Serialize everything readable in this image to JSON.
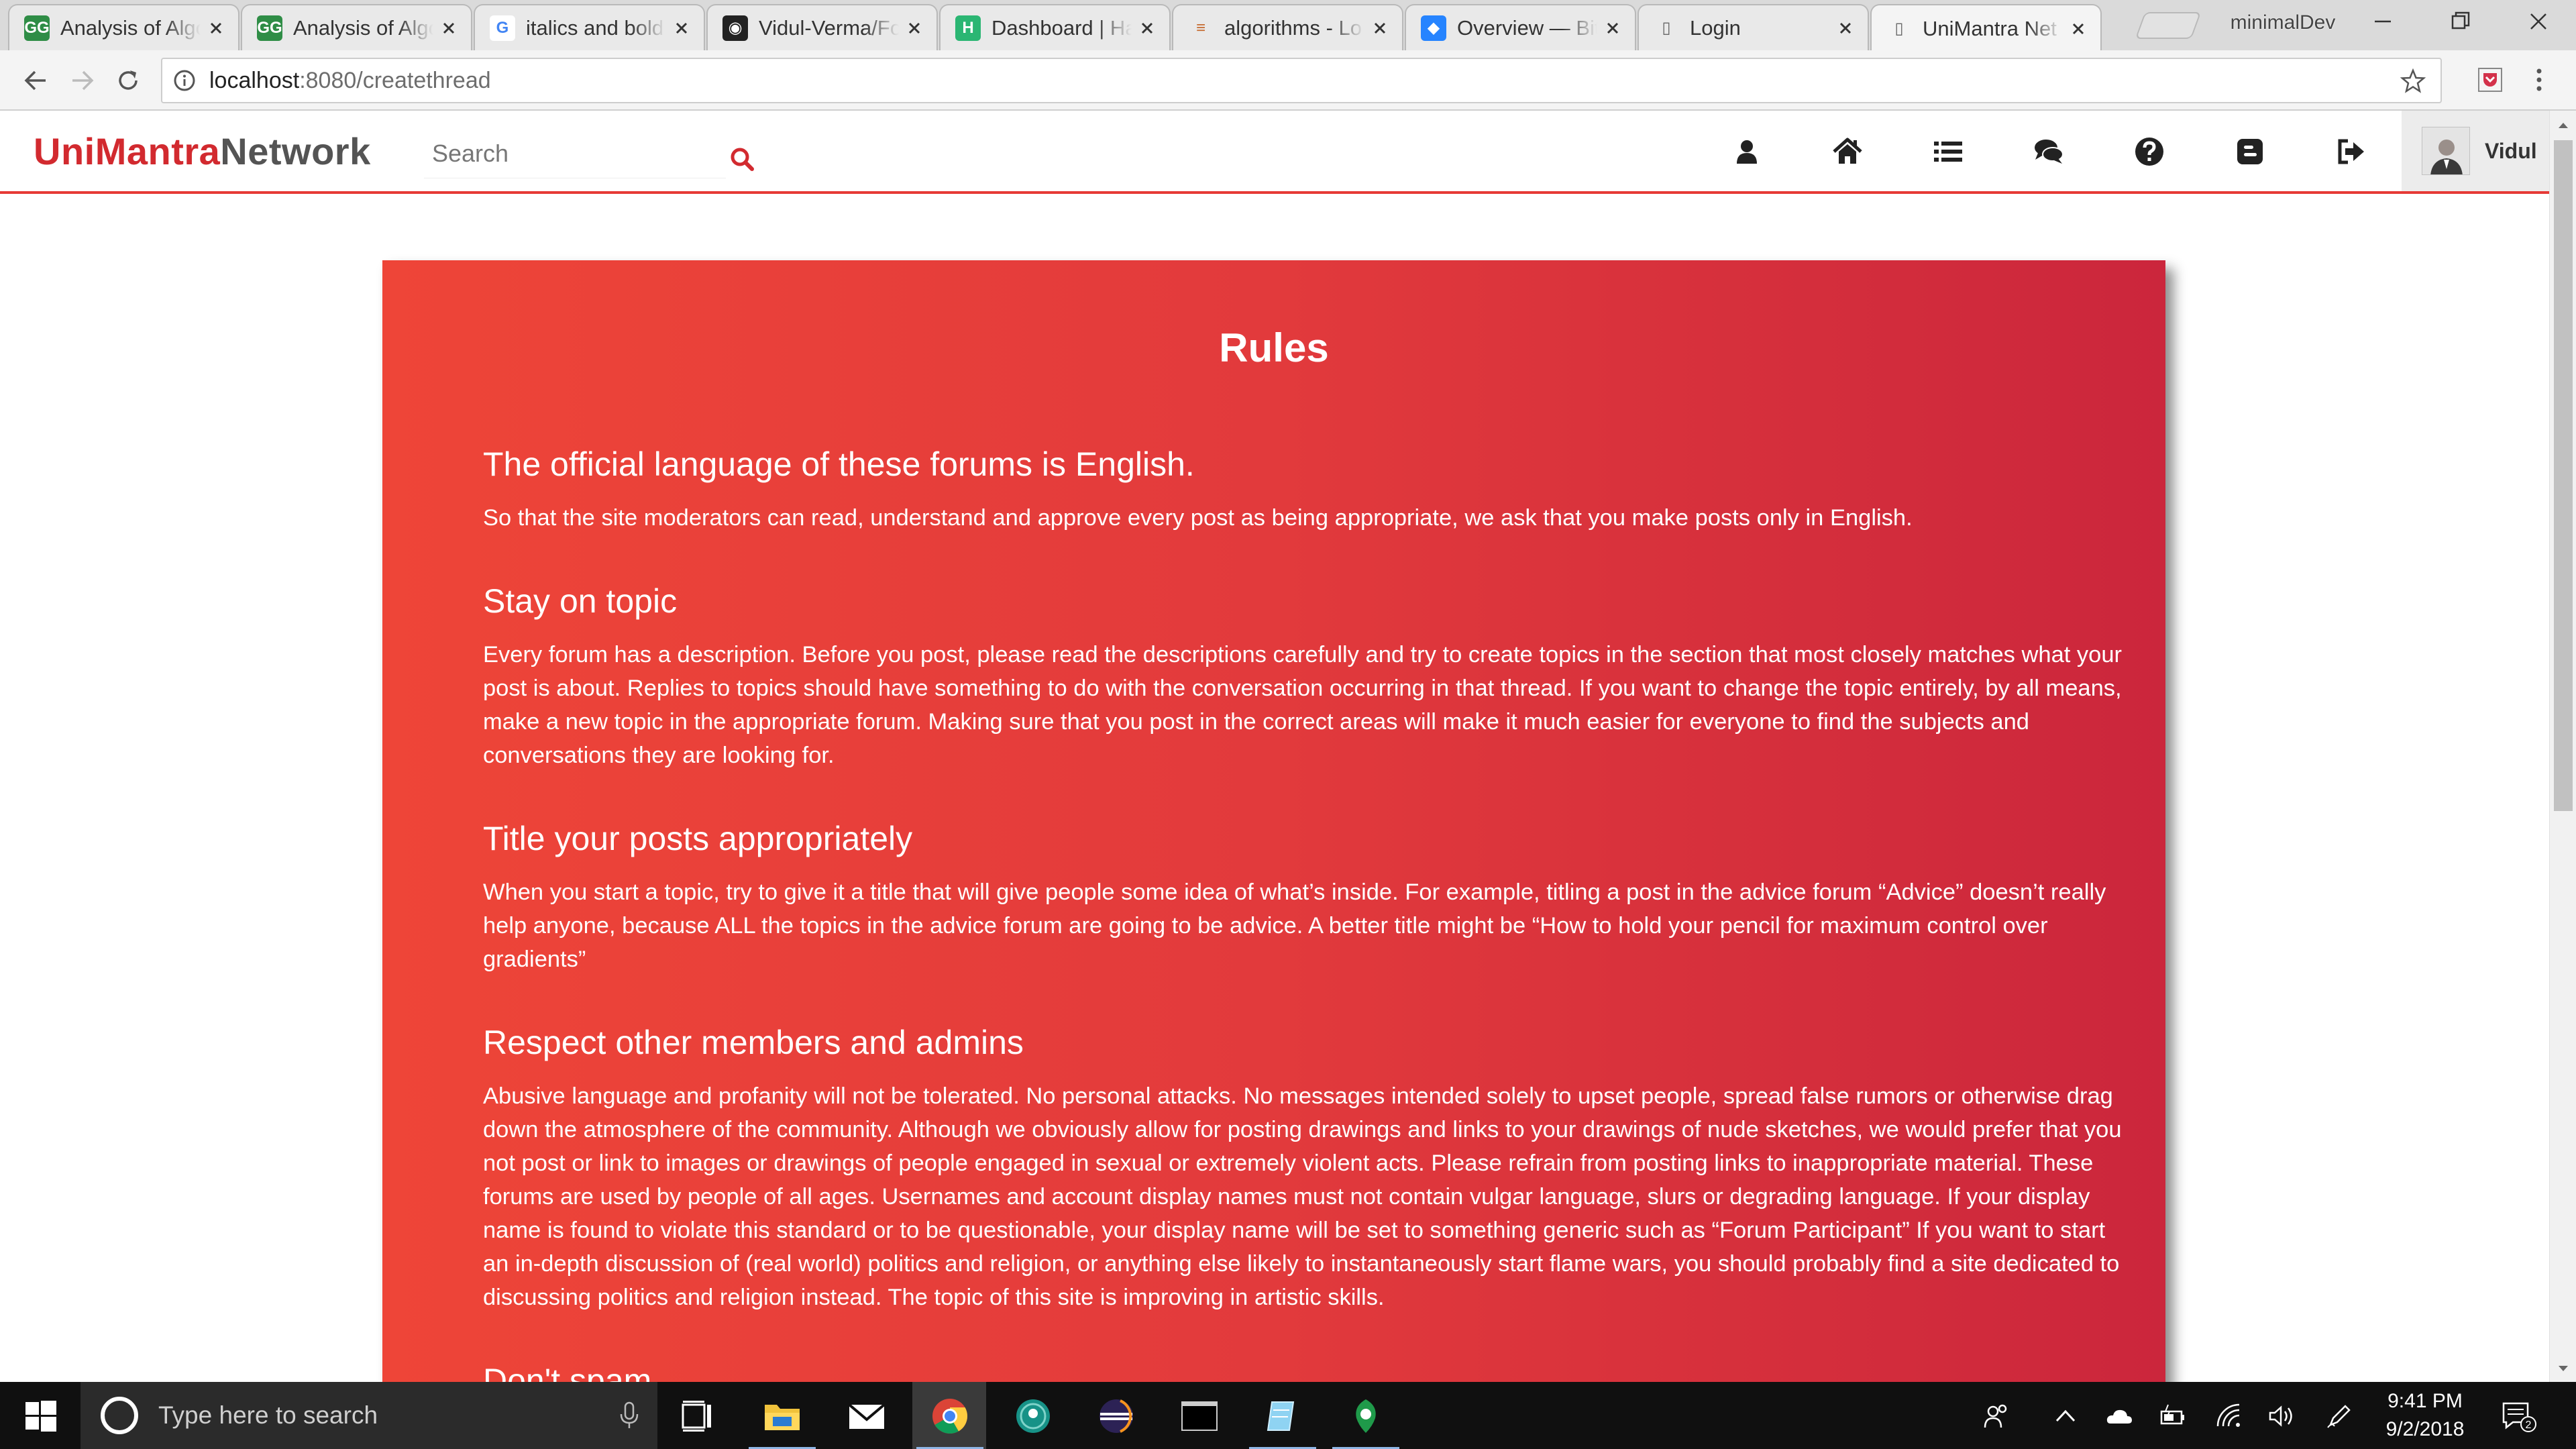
{
  "browser": {
    "tabs": [
      {
        "title": "Analysis of Algo",
        "favicon": "geeksforgeeks-icon"
      },
      {
        "title": "Analysis of Algo",
        "favicon": "geeksforgeeks-icon"
      },
      {
        "title": "italics and bold",
        "favicon": "google-icon"
      },
      {
        "title": "Vidul-Verma/Fo",
        "favicon": "github-icon"
      },
      {
        "title": "Dashboard | Ha",
        "favicon": "hackerearth-icon"
      },
      {
        "title": "algorithms - Lo",
        "favicon": "stack-exchange-icon"
      },
      {
        "title": "Overview — Bit",
        "favicon": "bitbucket-icon"
      },
      {
        "title": "Login",
        "favicon": "page-icon"
      },
      {
        "title": "UniMantra Net",
        "favicon": "page-icon",
        "active": true
      }
    ],
    "profile_name": "minimalDev",
    "url_host": "localhost",
    "url_rest": ":8080/createthread"
  },
  "site": {
    "brand_part1": "UniMantra",
    "brand_part2": "Network",
    "search_placeholder": "Search",
    "nav_icons": [
      "user-icon",
      "home-icon",
      "list-icon",
      "comments-icon",
      "question-icon",
      "blogger-icon",
      "sign-out-icon"
    ],
    "user_name": "Vidul",
    "colors": {
      "brand_red": "#d22a2f",
      "card_gradient_start": "#ee4538",
      "card_gradient_end": "#cb263c"
    }
  },
  "rules": {
    "title": "Rules",
    "items": [
      {
        "heading": "The official language of these forums is English.",
        "body": "So that the site moderators can read, understand and approve every post as being appropriate, we ask that you make posts only in English."
      },
      {
        "heading": "Stay on topic",
        "body": "Every forum has a description. Before you post, please read the descriptions carefully and try to create topics in the section that most closely matches what your post is about. Replies to topics should have something to do with the conversation occurring in that thread. If you want to change the topic entirely, by all means, make a new topic in the appropriate forum. Making sure that you post in the correct areas will make it much easier for everyone to find the subjects and conversations they are looking for."
      },
      {
        "heading": "Title your posts appropriately",
        "body": "When you start a topic, try to give it a title that will give people some idea of what’s inside. For example, titling a post in the advice forum “Advice” doesn’t really help anyone, because ALL the topics in the advice forum are going to be advice. A better title might be “How to hold your pencil for maximum control over gradients”"
      },
      {
        "heading": "Respect other members and admins",
        "body": "Abusive language and profanity will not be tolerated. No personal attacks. No messages intended solely to upset people, spread false rumors or otherwise drag down the atmosphere of the community. Although we obviously allow for posting drawings and links to your drawings of nude sketches, we would prefer that you not post or link to images or drawings of people engaged in sexual or extremely violent acts. Please refrain from posting links to inappropriate material. These forums are used by people of all ages. Usernames and account display names must not contain vulgar language, slurs or degrading language. If your display name is found to violate this standard or to be questionable, your display name will be set to something generic such as “Forum Participant” If you want to start an in-depth discussion of (real world) politics and religion, or anything else likely to instantaneously start flame wars, you should probably find a site dedicated to discussing politics and religion instead. The topic of this site is improving in artistic skills."
      },
      {
        "heading": "Don't spam",
        "body": ""
      }
    ]
  },
  "taskbar": {
    "search_placeholder": "Type here to search",
    "time": "9:41 PM",
    "date": "9/2/2018",
    "notification_count": "2",
    "apps": [
      "task-view-icon",
      "file-explorer-icon",
      "mail-icon",
      "chrome-icon",
      "gitkraken-icon",
      "eclipse-icon",
      "terminal-icon",
      "notepad-icon",
      "sourcetree-icon"
    ],
    "tray": [
      "people-icon",
      "chevron-up-icon",
      "onedrive-icon",
      "battery-icon",
      "wifi-icon",
      "volume-icon",
      "pen-icon"
    ]
  }
}
